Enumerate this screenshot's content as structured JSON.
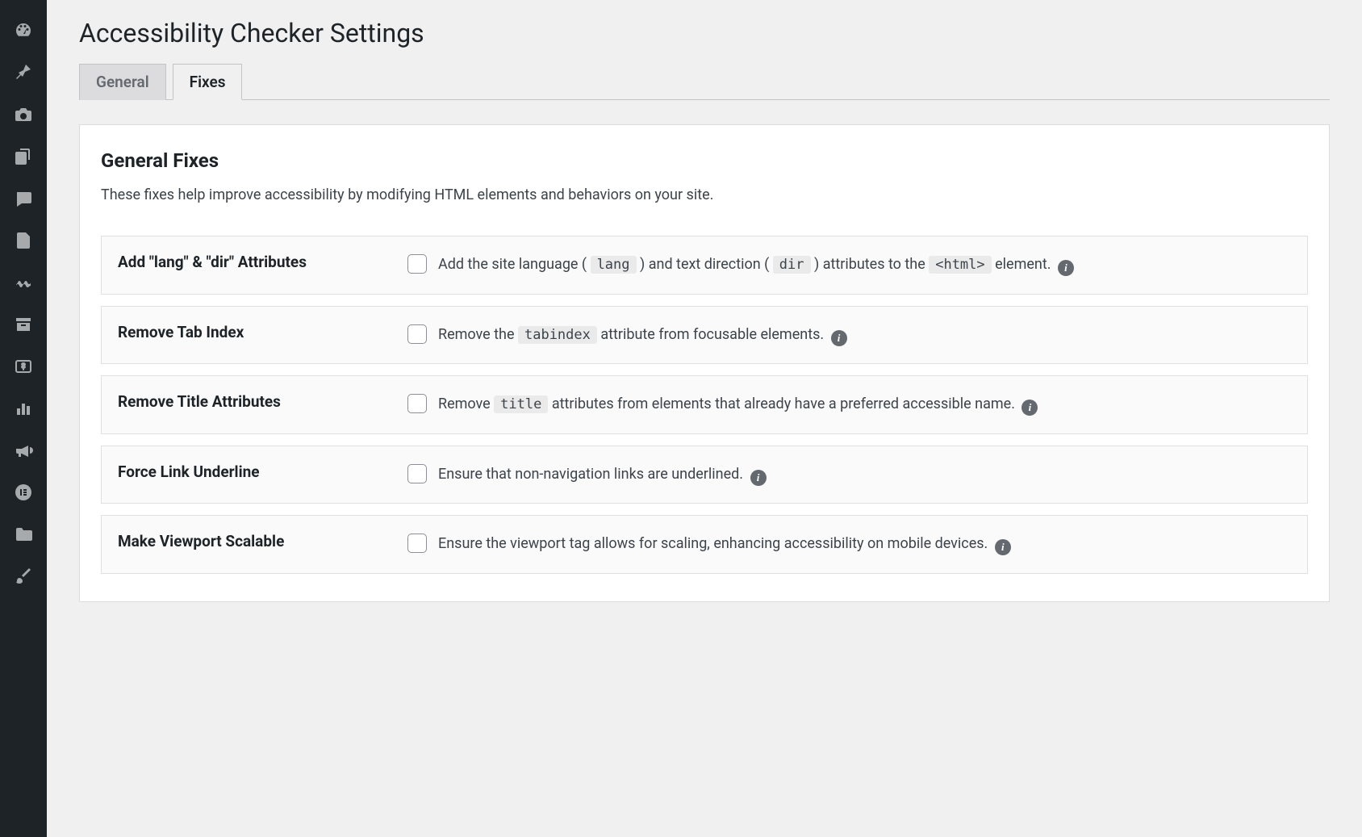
{
  "sidebar": {
    "items": [
      {
        "name": "dashboard-icon"
      },
      {
        "name": "pin-icon"
      },
      {
        "name": "media-icon"
      },
      {
        "name": "pages-icon"
      },
      {
        "name": "comments-icon"
      },
      {
        "name": "forms-icon"
      },
      {
        "name": "wave-icon"
      },
      {
        "name": "archive-icon"
      },
      {
        "name": "payments-icon"
      },
      {
        "name": "analytics-icon"
      },
      {
        "name": "marketing-icon"
      },
      {
        "name": "elementor-icon"
      },
      {
        "name": "templates-icon"
      },
      {
        "name": "tools-icon"
      }
    ]
  },
  "header": {
    "title": "Accessibility Checker Settings"
  },
  "tabs": [
    {
      "label": "General",
      "active": false
    },
    {
      "label": "Fixes",
      "active": true
    }
  ],
  "section": {
    "heading": "General Fixes",
    "description": "These fixes help improve accessibility by modifying HTML elements and behaviors on your site."
  },
  "info_glyph": "i",
  "fixes": [
    {
      "label": "Add \"lang\" & \"dir\" Attributes",
      "desc_parts": [
        "Add the site language ( ",
        "lang",
        " ) and text direction ( ",
        "dir",
        " ) attributes to the ",
        "<html>",
        " element."
      ]
    },
    {
      "label": "Remove Tab Index",
      "desc_parts": [
        "Remove the ",
        "tabindex",
        " attribute from focusable elements."
      ]
    },
    {
      "label": "Remove Title Attributes",
      "desc_parts": [
        "Remove ",
        "title",
        " attributes from elements that already have a preferred accessible name."
      ]
    },
    {
      "label": "Force Link Underline",
      "desc_parts": [
        "Ensure that non-navigation links are underlined."
      ]
    },
    {
      "label": "Make Viewport Scalable",
      "desc_parts": [
        "Ensure the viewport tag allows for scaling, enhancing accessibility on mobile devices."
      ]
    }
  ]
}
